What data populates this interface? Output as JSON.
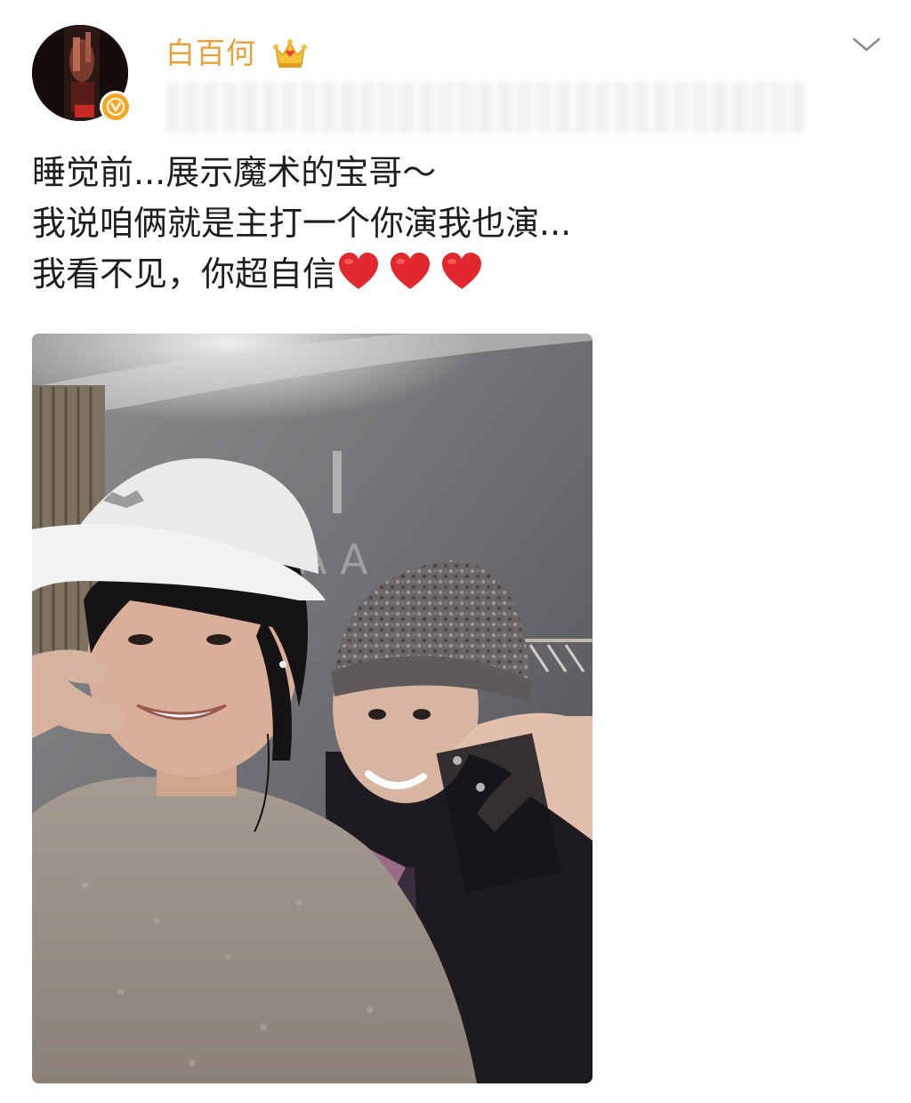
{
  "post": {
    "username": "白百何",
    "text_lines": [
      "睡觉前...展示魔术的宝哥～",
      "我说咱俩就是主打一个你演我也演...",
      "我看不见，你超自信"
    ],
    "hearts": [
      "red-heart-icon",
      "red-heart-icon",
      "red-heart-icon"
    ],
    "icons": {
      "verified": "verified-v-icon",
      "member": "crown-icon",
      "more": "chevron-down-icon"
    },
    "colors": {
      "username": "#e8a13a",
      "verified_badge": "#f6a623",
      "heart": "#e0282e"
    }
  }
}
